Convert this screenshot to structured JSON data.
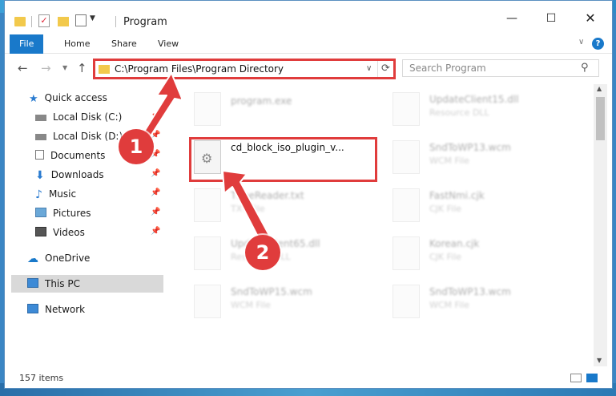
{
  "window": {
    "title": "Program",
    "controls": {
      "minimize": "—",
      "maximize": "☐",
      "close": "✕"
    }
  },
  "ribbon": {
    "tabs": [
      "File",
      "Home",
      "Share",
      "View"
    ]
  },
  "address": {
    "path": "C:\\Program Files\\Program Directory",
    "search_placeholder": "Search Program"
  },
  "nav": {
    "quick_access": "Quick access",
    "pinned": [
      {
        "label": "Local Disk (C:)",
        "icon": "drive-icon"
      },
      {
        "label": "Local Disk (D:)",
        "icon": "drive-icon"
      },
      {
        "label": "Documents",
        "icon": "documents-icon"
      },
      {
        "label": "Downloads",
        "icon": "downloads-icon"
      },
      {
        "label": "Music",
        "icon": "music-icon"
      },
      {
        "label": "Pictures",
        "icon": "pictures-icon"
      },
      {
        "label": "Videos",
        "icon": "videos-icon"
      }
    ],
    "onedrive": "OneDrive",
    "this_pc": "This PC",
    "network": "Network"
  },
  "files": {
    "highlighted": {
      "name": "cd_block_iso_plugin_v...",
      "type": ""
    },
    "left_column": [
      {
        "name": "program.exe",
        "type": ""
      },
      {
        "name": "TfineReader.txt",
        "type": "TXT File"
      },
      {
        "name": "UpdateClient65.dll",
        "type": "Resource DLL"
      },
      {
        "name": "SndToWP15.wcm",
        "type": "WCM File"
      }
    ],
    "right_column": [
      {
        "name": "UpdateClient15.dll",
        "type": "Resource DLL"
      },
      {
        "name": "SndToWP13.wcm",
        "type": "WCM File"
      },
      {
        "name": "FastNmi.cjk",
        "type": "CJK File"
      },
      {
        "name": "Korean.cjk",
        "type": "CJK File"
      },
      {
        "name": "SndToWP13.wcm",
        "type": "WCM File"
      }
    ]
  },
  "status": {
    "count": "157 items"
  },
  "annotations": {
    "step1": "1",
    "step2": "2",
    "color": "#e03c3c"
  }
}
